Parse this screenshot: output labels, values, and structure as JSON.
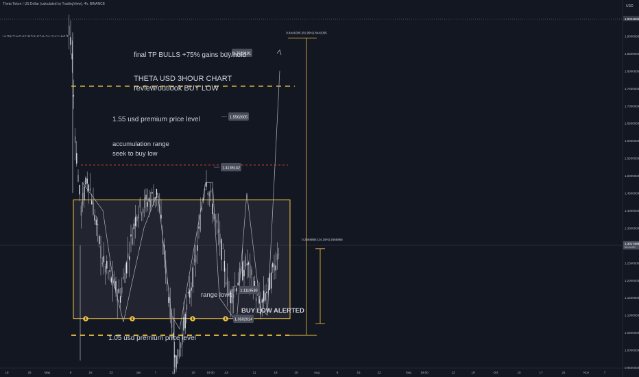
{
  "header": {
    "symbol_line": "Theta Token / US Dollar (calculated by TradingView), 4h, BINANCE"
  },
  "price_axis": {
    "currency": "USD",
    "ticks": [
      {
        "value": 1.9,
        "label": "1.9000000"
      },
      {
        "value": 1.85,
        "label": "1.8500000"
      },
      {
        "value": 1.8,
        "label": "1.8000000"
      },
      {
        "value": 1.75,
        "label": "1.7500000"
      },
      {
        "value": 1.7,
        "label": "1.7000000"
      },
      {
        "value": 1.65,
        "label": "1.6500000"
      },
      {
        "value": 1.6,
        "label": "1.6000000"
      },
      {
        "value": 1.55,
        "label": "1.5500000"
      },
      {
        "value": 1.5,
        "label": "1.5000000"
      },
      {
        "value": 1.45,
        "label": "1.4500000"
      },
      {
        "value": 1.4,
        "label": "1.4000000"
      },
      {
        "value": 1.35,
        "label": "1.3500000"
      },
      {
        "value": 1.25,
        "label": "1.2500000"
      },
      {
        "value": 1.2,
        "label": "1.2000000"
      },
      {
        "value": 1.15,
        "label": "1.1500000"
      },
      {
        "value": 1.1,
        "label": "1.1000000"
      },
      {
        "value": 1.05,
        "label": "1.0500000"
      },
      {
        "value": 1.0,
        "label": "1.0000000"
      },
      {
        "value": 0.95,
        "label": "0.9500000"
      }
    ],
    "top_label": "1.9044005",
    "current_price": "1.3017488",
    "current_countdown": "00:44:50"
  },
  "time_axis": {
    "labels": [
      "18",
      "25",
      "May",
      "9",
      "16",
      "23",
      "Jun",
      "7",
      "13",
      "20",
      "19:00",
      "Jul",
      "11",
      "18",
      "25",
      "Aug",
      "8",
      "15",
      "22",
      "Sep",
      "19:00",
      "12",
      "19",
      "Oct",
      "10",
      "17",
      "24",
      "Nov",
      "7"
    ]
  },
  "chart_data": {
    "type": "candlestick",
    "title": "THETA USD 3HOUR CHART",
    "subtitle": "review/outlook BUY LOW",
    "ylim": [
      0.93,
      1.92
    ],
    "price_series_approx": [
      {
        "t": "Apr 18",
        "close": 1.9
      },
      {
        "t": "May 9",
        "close": 1.9
      },
      {
        "t": "May 10",
        "close": 1.6
      },
      {
        "t": "May 12",
        "close": 1.4
      },
      {
        "t": "May 14",
        "close": 1.5
      },
      {
        "t": "May 20",
        "close": 1.25
      },
      {
        "t": "May 25",
        "close": 1.15
      },
      {
        "t": "May 31",
        "close": 1.4
      },
      {
        "t": "Jun 6",
        "close": 1.45
      },
      {
        "t": "Jun 12",
        "close": 1.05
      },
      {
        "t": "Jun 14",
        "close": 0.96
      },
      {
        "t": "Jun 19",
        "close": 1.25
      },
      {
        "t": "Jun 25",
        "close": 1.5
      },
      {
        "t": "Jun 30",
        "close": 1.3
      },
      {
        "t": "Jul 3",
        "close": 1.15
      },
      {
        "t": "Jul 8",
        "close": 1.25
      },
      {
        "t": "Jul 14",
        "close": 1.12
      },
      {
        "t": "Jul 18",
        "close": 1.2
      },
      {
        "t": "Jul 21",
        "close": 1.3
      }
    ],
    "levels": [
      {
        "name": "final TP",
        "value": 1.7620181,
        "label": "1.7620181",
        "color": "#f5c542"
      },
      {
        "name": "premium 1.55",
        "value": 1.5562605,
        "label": "1.5562605",
        "color": "#c0392b"
      },
      {
        "name": "premium 1.05",
        "value": 1.05,
        "label": "",
        "color": "#f5c542"
      }
    ],
    "price_labels": [
      "1.7620181",
      "1.5562605",
      "1.4135142",
      "1.1119530",
      "1.0502914"
    ],
    "range_box": {
      "top": 1.43,
      "bottom": 1.09,
      "label": "accumulation range"
    },
    "measure_big": {
      "from": 1.05,
      "to": 1.89,
      "label": "0.8441005 (81.96%) 8441005"
    },
    "measure_small": {
      "from": 1.05,
      "to": 1.3,
      "label": "0.2565865 (24.15%) 2565865"
    },
    "annotations": [
      "final TP BULLS +75% gains buy/hold",
      "1.55 usd premium price level",
      "accumulation range",
      "seek to buy low",
      "range lows",
      "BUY LOW ALERTED",
      "1.05 usd premium price level"
    ],
    "zigzag_path": [
      [
        1.53,
        1.5
      ],
      [
        1.58,
        1.43
      ],
      [
        1.65,
        1.12
      ],
      [
        1.68,
        1.07
      ],
      [
        1.72,
        1.43
      ],
      [
        1.76,
        1.47
      ],
      [
        1.8,
        1.1
      ],
      [
        1.83,
        1.05
      ],
      [
        1.86,
        1.48
      ],
      [
        1.9,
        1.52
      ],
      [
        1.94,
        1.12
      ],
      [
        1.97,
        1.07
      ],
      [
        2.0,
        1.43
      ],
      [
        2.04,
        1.47
      ],
      [
        2.08,
        1.12
      ],
      [
        2.1,
        1.07
      ],
      [
        2.13,
        1.78
      ]
    ],
    "buy_markers": 4
  },
  "colors": {
    "bg": "#131722",
    "gold": "#f5c542",
    "red": "#c0392b",
    "grid": "#1e222d",
    "candle": "#cfd2d8"
  }
}
